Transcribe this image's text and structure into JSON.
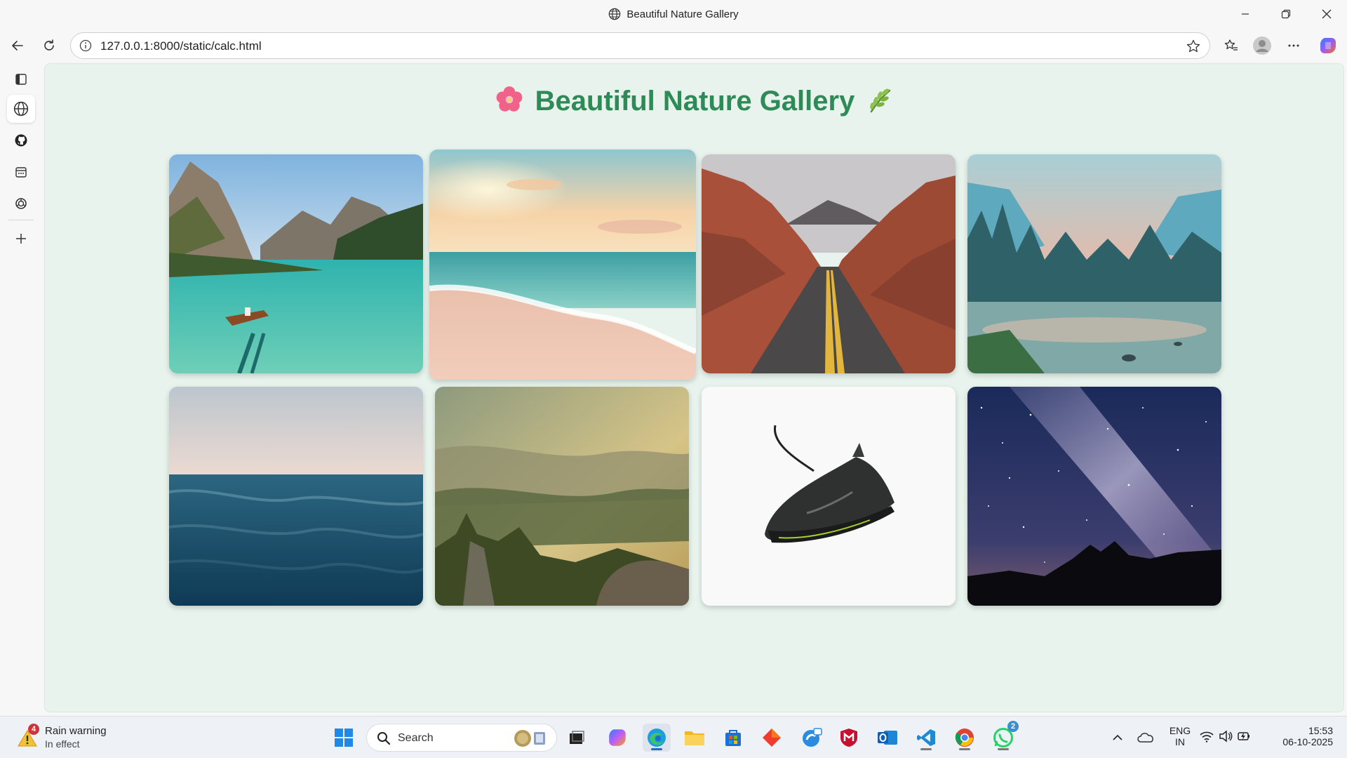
{
  "window": {
    "title": "Beautiful Nature Gallery"
  },
  "browser": {
    "url": "127.0.0.1:8000/static/calc.html"
  },
  "page": {
    "heading": "Beautiful Nature Gallery",
    "heading_color": "#2e8b57",
    "background": "#e7f3ec",
    "images": [
      {
        "name": "mountain-lake"
      },
      {
        "name": "beach-sunset"
      },
      {
        "name": "canyon-road"
      },
      {
        "name": "forest-river"
      },
      {
        "name": "ocean-waves"
      },
      {
        "name": "misty-hills"
      },
      {
        "name": "sneaker"
      },
      {
        "name": "milky-way"
      }
    ]
  },
  "taskbar": {
    "weather_title": "Rain warning",
    "weather_sub": "In effect",
    "weather_badge": "4",
    "search_label": "Search",
    "whatsapp_badge": "2",
    "lang_top": "ENG",
    "lang_bottom": "IN",
    "time": "15:53",
    "date": "06-10-2025"
  }
}
